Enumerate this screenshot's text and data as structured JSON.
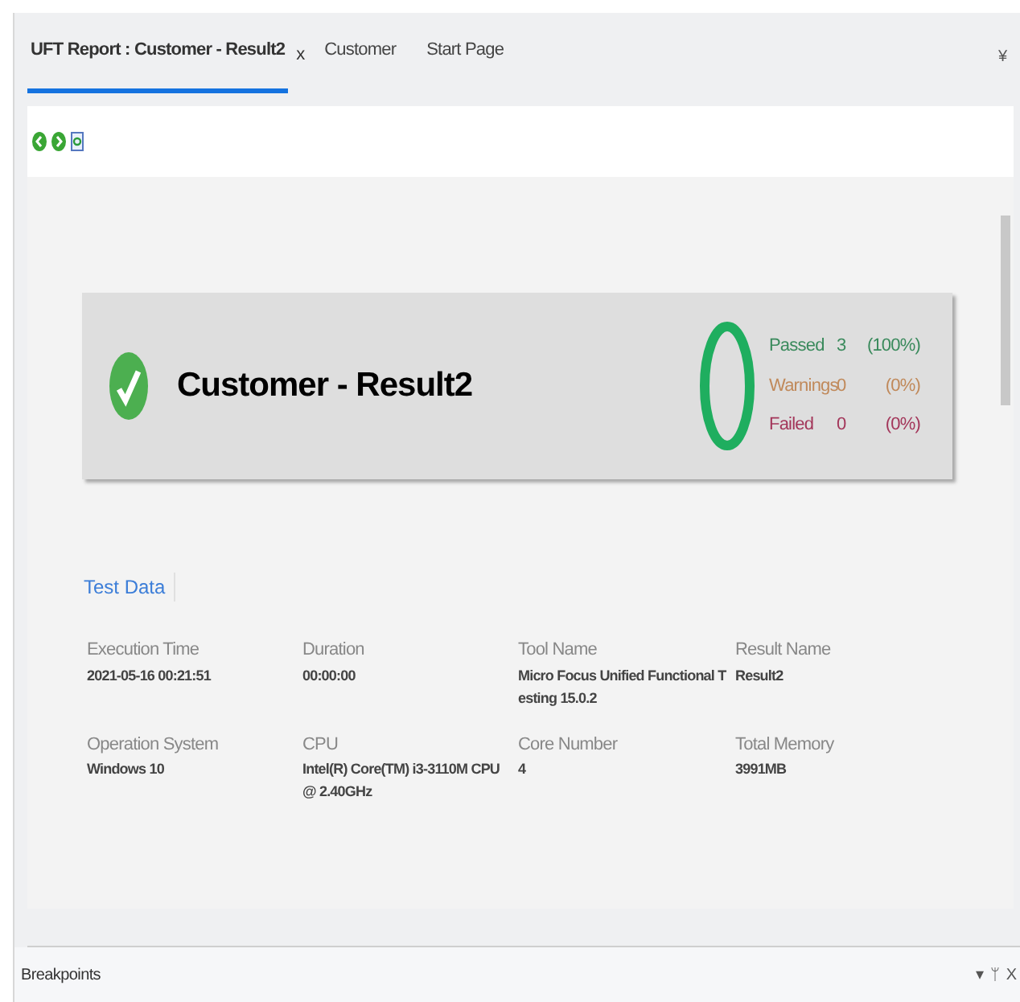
{
  "tabs": [
    {
      "label": "UFT Report : Customer - Result2",
      "close": "x",
      "selected": true
    },
    {
      "label": "Customer",
      "selected": false
    },
    {
      "label": "Start Page",
      "selected": false
    }
  ],
  "tab_menu": "¥",
  "summary": {
    "title": "Customer - Result2",
    "passed": true,
    "stats": [
      {
        "label": "Passed",
        "count": "3",
        "percent": "(100%)",
        "color": "#3a8a5c"
      },
      {
        "label": "Warnings",
        "count": "0",
        "percent": "(0%)",
        "color": "#c0895a"
      },
      {
        "label": "Failed",
        "count": "0",
        "percent": "(0%)",
        "color": "#a3365a"
      }
    ]
  },
  "section_title": "Test Data",
  "test_data": [
    {
      "label": "Execution Time",
      "value": "2021-05-16 00:21:51"
    },
    {
      "label": "Duration",
      "value": "00:00:00"
    },
    {
      "label": "Tool Name",
      "value": "Micro Focus Unified Functional Testing 15.0.2"
    },
    {
      "label": "Result Name",
      "value": "Result2"
    },
    {
      "label": "Operation System",
      "value": "Windows 10"
    },
    {
      "label": "CPU",
      "value": "Intel(R) Core(TM) i3-3110M CPU @ 2.40GHz"
    },
    {
      "label": "Core Number",
      "value": "4"
    },
    {
      "label": "Total Memory",
      "value": "3991MB"
    }
  ],
  "bottom_panel": {
    "title": "Breakpoints",
    "controls": [
      "▾",
      "ᛘ",
      "X"
    ]
  }
}
